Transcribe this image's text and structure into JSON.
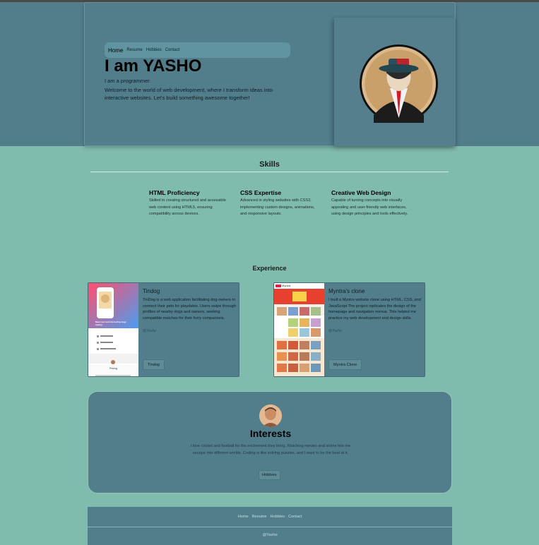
{
  "colors": {
    "page_bg": "#80bcae",
    "panel_bg": "#527e8c",
    "nav_bg": "#5f94a0"
  },
  "header": {
    "nav": [
      "Home",
      "Resume",
      "Hobbies",
      "Contact"
    ],
    "title": "I am YASHO",
    "subtitle": "I am a programmer",
    "description": "Welcome to the world of web development, where I transform ideas into interactive websites. Let's build something awesome together!"
  },
  "skills": {
    "title": "Skills",
    "items": [
      {
        "title": "HTML Proficiency",
        "text": "Skilled in creating structured and accessible web content using HTML5, ensuring compatibility across devices."
      },
      {
        "title": "CSS Expertise",
        "text": "Advanced in styling websites with CSS3, implementing custom designs, animations, and responsive layouts."
      },
      {
        "title": "Creative Web Design",
        "text": "Capable of turning concepts into visually appealing and user-friendly web interfaces, using design principles and tools effectively."
      }
    ]
  },
  "experience": {
    "title": "Experience",
    "projects": [
      {
        "title": "Tindog",
        "text": "TinDog is a web application facilitating dog owners to connect their pets for playdates. Users swipe through profiles of nearby dogs and owners, seeking compatible matches for their furry companions.",
        "author": "@Yasho",
        "button": "Tindog",
        "thumb_heading": "Meet new and interesting dogs nearby.",
        "thumb_label": "Pricing"
      },
      {
        "title": "Myntra's clone",
        "text": "I built a Myntra website clone using HTML, CSS, and JavaScript.The project replicates the design of the homepage and navigation menus. This helped me practice my web development and design skills.",
        "author": "@Yasho",
        "button": "Myntra Clone",
        "thumb_brand": "Myntra"
      }
    ]
  },
  "interests": {
    "title": "Interests",
    "text": "I love cricket and football for the excitement they bring. Watching movies and anime lets me escape into different worlds. Coding is like solving puzzles, and I want to be the best at it.",
    "button": "Hobbies"
  },
  "footer": {
    "nav": [
      "Home",
      "Resume",
      "Hobbies",
      "Contact"
    ],
    "copyright": "@Yasho"
  }
}
